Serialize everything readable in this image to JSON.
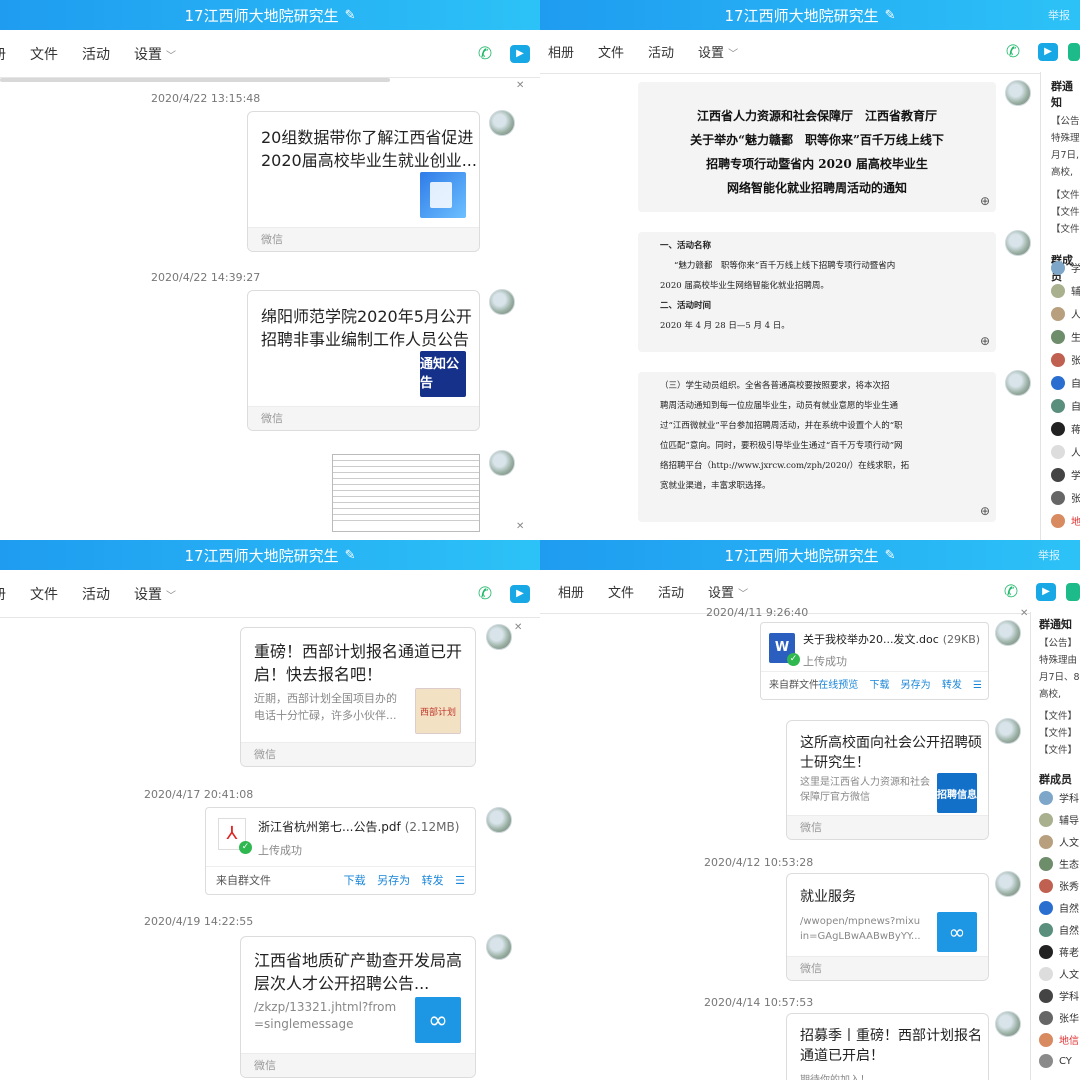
{
  "title": "17江西师大地院研究生",
  "edit_icon": "pencil-icon",
  "report": "举报",
  "toolbar": {
    "album": "相册",
    "files": "文件",
    "activity": "活动",
    "settings": "设置"
  },
  "pane1": {
    "timestamps": [
      "2020/4/22 13:15:48",
      "2020/4/22 14:39:27"
    ],
    "cards": [
      {
        "title_l1": "20组数据带你了解江西省促进",
        "title_l2": "2020届高校毕业生就业创业...",
        "source": "微信"
      },
      {
        "title_l1": "绵阳师范学院2020年5月公开",
        "title_l2": "招聘非事业编制工作人员公告",
        "thumb_text": "通知公告",
        "source": "微信"
      }
    ]
  },
  "pane2": {
    "doc1": {
      "l1": "江西省人力资源和社会保障厅　江西省教育厅",
      "l2": "关于举办“魅力赣鄱　职等你来”百千万线上线下",
      "l3": "招聘专项行动暨省内 2020 届高校毕业生",
      "l4": "网络智能化就业招聘周活动的通知"
    },
    "doc2": {
      "l1": "一、活动名称",
      "l2": "“魅力赣鄱　职等你来”百千万线上线下招聘专项行动暨省内",
      "l3": "2020 届高校毕业生网络智能化就业招聘周。",
      "l4": "二、活动时间",
      "l5": "2020 年 4 月 28 日—5 月 4 日。"
    },
    "doc3": {
      "l1": "（三）学生动员组织。全省各普通高校要按照要求，将本次招",
      "l2": "聘周活动通知到每一位应届毕业生，动员有就业意愿的毕业生通",
      "l3": "过“江西微就业”平台参加招聘周活动，并在系统中设置个人的“职",
      "l4": "位匹配”意向。同时，要积极引导毕业生通过“百千万专项行动”网",
      "l5": "络招聘平台（http://www.jxrcw.com/zph/2020/）在线求职，拓",
      "l6": "宽就业渠道，丰富求职选择。"
    },
    "sidebar": {
      "notice_title": "群通知",
      "notice_l1": "【公告】",
      "notice_l2": "特殊理",
      "notice_l3": "月7日,",
      "notice_l4": "高校,",
      "file1": "【文件】",
      "file2": "【文件】",
      "file3": "【文件】",
      "members_title": "群成员",
      "members": [
        "学",
        "辅",
        "人",
        "生",
        "张",
        "自",
        "自",
        "蒋",
        "人",
        "学",
        "张",
        "地"
      ]
    }
  },
  "pane3": {
    "timestamps": [
      "2020/4/17 20:41:08",
      "2020/4/19 14:22:55"
    ],
    "card1": {
      "title_l1": "重磅！西部计划报名通道已开",
      "title_l2": "启！快去报名吧！",
      "desc_l1": "近期，西部计划全国项目办的",
      "desc_l2": "电话十分忙碌，许多小伙伴...",
      "thumb_text": "西部计划",
      "source": "微信"
    },
    "file": {
      "name": "浙江省杭州第七...公告.pdf",
      "size": "(2.12MB)",
      "status": "上传成功",
      "origin": "来自群文件",
      "download": "下载",
      "save_as": "另存为",
      "forward": "转发"
    },
    "card2": {
      "title_l1": "江西省地质矿产勘查开发局高",
      "title_l2": "层次人才公开招聘公告...",
      "desc_l1": "/zkzp/13321.jhtml?from",
      "desc_l2": "=singlemessage",
      "source": "微信"
    }
  },
  "pane4": {
    "timestamps": [
      "2020/4/11 9:26:40",
      "2020/4/12 10:53:28",
      "2020/4/14 10:57:53"
    ],
    "file": {
      "name": "关于我校举办20...发文.doc",
      "size": "(29KB)",
      "status": "上传成功",
      "origin": "来自群文件",
      "preview": "在线预览",
      "download": "下载",
      "save_as": "另存为",
      "forward": "转发"
    },
    "card1": {
      "title_l1": "这所高校面向社会公开招聘硕",
      "title_l2": "士研究生！",
      "desc_l1": "这里是江西省人力资源和社会",
      "desc_l2": "保障厅官方微信",
      "thumb_text": "招聘信息",
      "source": "微信"
    },
    "card2": {
      "title": "就业服务",
      "desc_l1": "/wwopen/mpnews?mixu",
      "desc_l2": "in=GAgLBwAABwByYY...",
      "source": "微信"
    },
    "card3": {
      "title_l1": "招募季丨重磅！西部计划报名",
      "title_l2": "通道已开启！",
      "desc": "期待你的加入！"
    },
    "sidebar": {
      "notice_title": "群通知",
      "notice_l1": "【公告】",
      "notice_l2": "特殊理由",
      "notice_l3": "月7日、8",
      "notice_l4": "高校,",
      "file1": "【文件】",
      "file2": "【文件】",
      "file3": "【文件】",
      "members_title": "群成员",
      "members": [
        "学科",
        "辅导",
        "人文",
        "生态",
        "张秀",
        "自然",
        "自然",
        "蒋老",
        "人文",
        "学科",
        "张华",
        "地信",
        "CY"
      ]
    }
  }
}
